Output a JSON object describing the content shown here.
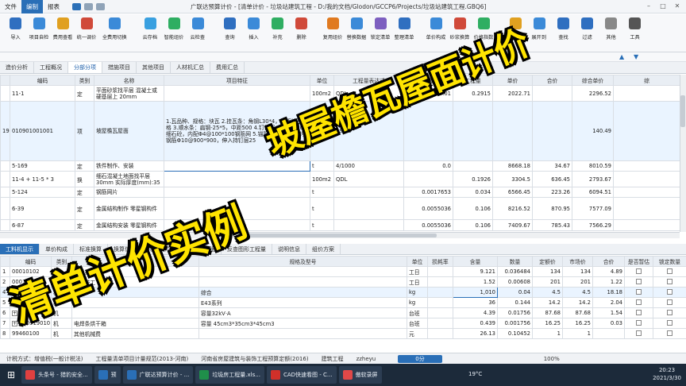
{
  "titlebar": {
    "menus": [
      "文件",
      "编制",
      "报表"
    ],
    "title": "广联达预算计价 - [清单计价 - 垃圾站建筑工程 - D:/我的文档/Glodon/GCCP6/Projects/垃圾站建筑工程.GBQ6]"
  },
  "ribbon": {
    "buttons": [
      {
        "label": "导入",
        "color": "#2f6fc0"
      },
      {
        "label": "项目自检",
        "color": "#3b8ad8"
      },
      {
        "label": "费用查看",
        "color": "#e0a020"
      },
      {
        "label": "统一调价",
        "color": "#d04a3a"
      },
      {
        "label": "全费用切换",
        "color": "#3b8ad8"
      },
      {
        "label": "云存档",
        "color": "#39a0e0"
      },
      {
        "label": "智能组价",
        "color": "#2fae62"
      },
      {
        "label": "云检查",
        "color": "#3b8ad8"
      },
      {
        "label": "查询",
        "color": "#2f6fc0"
      },
      {
        "label": "插入",
        "color": "#3b8ad8"
      },
      {
        "label": "补充",
        "color": "#2fae62"
      },
      {
        "label": "删除",
        "color": "#d04a3a"
      },
      {
        "label": "复用组价",
        "color": "#e07a20"
      },
      {
        "label": "替换数据",
        "color": "#3b8ad8"
      },
      {
        "label": "锁定清单",
        "color": "#7d5fc0"
      },
      {
        "label": "整理清单",
        "color": "#2f6fc0"
      },
      {
        "label": "单价构成",
        "color": "#3b8ad8"
      },
      {
        "label": "砂浆换算",
        "color": "#d04a3a"
      },
      {
        "label": "价格指数",
        "color": "#2fae62"
      },
      {
        "label": "颜色",
        "color": "#e0a020"
      },
      {
        "label": "展开到",
        "color": "#3b8ad8"
      },
      {
        "label": "查找",
        "color": "#2f6fc0"
      },
      {
        "label": "过滤",
        "color": "#2f6fc0"
      },
      {
        "label": "其他",
        "color": "#888888"
      },
      {
        "label": "工具",
        "color": "#555555"
      }
    ]
  },
  "top_tabs": [
    "造价分析",
    "工程概况",
    "分部分项",
    "措施项目",
    "其他项目",
    "人材机汇总",
    "费用汇总"
  ],
  "upper_table": {
    "headers": [
      "",
      "编码",
      "类别",
      "名称",
      "项目特征",
      "单位",
      "工程量表达式",
      "含量",
      "工程量",
      "单价",
      "合价",
      "综合单价",
      "综"
    ],
    "rows": [
      {
        "idx": "",
        "code": "11-1",
        "type": "定",
        "name": "平面砂浆找平层 混凝土或硬基层上 20mm",
        "feature": "",
        "unit": "100m2",
        "expr": "QDL",
        "content": "0.01",
        "qty": "0.2915",
        "price": "2022.71",
        "total": "",
        "unit_price": "2296.52"
      },
      {
        "idx": "19",
        "code": "010901001001",
        "type": "项",
        "name": "坡屋檐瓦屋面",
        "feature": "1.瓦品种、规格：块瓦 2.挂瓦条：角钢L30*4，中距按瓦规格 3.顺水条：扁钢-25*5，中距500 4.钉挂层：35厚C20细石砼，内配Φ4@100*100钢筋网 5.锚筋：屋面板内预埋钢筋Φ10@900*900，伸入持钉层25",
        "unit": "m2",
        "expr": "19.26",
        "content": "",
        "qty": "",
        "price": "",
        "total": "",
        "unit_price": "140.49"
      },
      {
        "idx": "",
        "code": "5-169",
        "type": "定",
        "name": "铁件制作、安装",
        "feature": "",
        "unit": "t",
        "expr": "4/1000",
        "content": "0.0",
        "qty": "",
        "price": "8668.18",
        "total": "34.67",
        "unit_price": "8010.59"
      },
      {
        "idx": "",
        "code": "11-4 + 11-5 * 3",
        "type": "换",
        "name": "细石混凝土地面找平层 30mm 实际厚度(mm):35",
        "feature": "",
        "unit": "100m2",
        "expr": "QDL",
        "content": "",
        "qty": "0.1926",
        "price": "3304.5",
        "total": "636.45",
        "unit_price": "2793.67"
      },
      {
        "idx": "",
        "code": "5-124",
        "type": "定",
        "name": "钢筋网片",
        "feature": "",
        "unit": "t",
        "expr": "",
        "content": "0.0017653",
        "qty": "0.034",
        "price": "6566.45",
        "total": "223.26",
        "unit_price": "6094.51"
      },
      {
        "idx": "",
        "code": "6-39",
        "type": "定",
        "name": "金属结构制作 零星钢构件",
        "feature": "",
        "unit": "t",
        "expr": "",
        "content": "0.0055036",
        "qty": "0.106",
        "price": "8216.52",
        "total": "870.95",
        "unit_price": "7577.09"
      },
      {
        "idx": "",
        "code": "6-87",
        "type": "定",
        "name": "金属结构安装 零星钢构件",
        "feature": "",
        "unit": "t",
        "expr": "",
        "content": "0.0055036",
        "qty": "0.106",
        "price": "7409.67",
        "total": "785.43",
        "unit_price": "7566.29"
      }
    ]
  },
  "bottom_tabs": [
    "工料机显示",
    "单价构成",
    "标准换算",
    "换算信息",
    "特征及内容",
    "工程量明细",
    "反查图形工程量",
    "说明信息",
    "组价方案"
  ],
  "lower_table": {
    "headers": [
      "",
      "编码",
      "类别",
      "名称",
      "规格及型号",
      "单位",
      "损耗率",
      "含量",
      "数量",
      "定额价",
      "市场价",
      "合价",
      "是否暂估",
      "锁定数量"
    ],
    "rows": [
      {
        "idx": "1",
        "code": "00010102",
        "type": "人",
        "name": "一般技工",
        "spec": "",
        "unit": "工日",
        "loss": "",
        "content": "9.121",
        "qty": "0.036484",
        "base": "134",
        "market": "134",
        "total": "4.89"
      },
      {
        "idx": "2",
        "code": "00010103",
        "type": "人",
        "name": "高级技工",
        "spec": "",
        "unit": "工日",
        "loss": "",
        "content": "1.52",
        "qty": "0.00608",
        "base": "201",
        "market": "201",
        "total": "1.22"
      },
      {
        "idx": "4",
        "code": "03210593",
        "type": "材",
        "name": "",
        "spec": "综合",
        "unit": "kg",
        "loss": "",
        "content": "1,010",
        "qty": "0.04",
        "base": "4.5",
        "market": "4.5",
        "total": "18.18"
      },
      {
        "idx": "5",
        "code": "03130921",
        "type": "材",
        "name": "",
        "spec": "E43系列",
        "unit": "kg",
        "loss": "",
        "content": "36",
        "qty": "0.144",
        "base": "14.2",
        "market": "14.2",
        "total": "2.04"
      },
      {
        "idx": "6",
        "code": "990904040",
        "type": "机",
        "name": "",
        "spec": "容量32kV·A",
        "unit": "台班",
        "loss": "",
        "content": "4.39",
        "qty": "0.01756",
        "base": "87.68",
        "market": "87.68",
        "total": "1.54"
      },
      {
        "idx": "7",
        "code": "990919010",
        "type": "机",
        "name": "电焊条烘干箱",
        "spec": "容量 45cm3*35cm3*45cm3",
        "unit": "台班",
        "loss": "",
        "content": "0.439",
        "qty": "0.001756",
        "base": "16.25",
        "market": "16.25",
        "total": "0.03"
      },
      {
        "idx": "8",
        "code": "99460100",
        "type": "机",
        "name": "其他机械费",
        "spec": "",
        "unit": "元",
        "loss": "",
        "content": "26.13",
        "qty": "0.10452",
        "base": "1",
        "market": "1",
        "total": ""
      }
    ]
  },
  "statusbar": {
    "items": [
      "计税方式：增值税(一般计税法)",
      "工程量清单项目计量规范(2013-河南)",
      "河南省房屋建筑与装饰工程预算定额(2016)",
      "建筑工程",
      "zzheyu"
    ],
    "score": "0分",
    "zoom": "100%"
  },
  "taskbar": {
    "items": [
      {
        "label": "头条号 - 猎豹安全...",
        "color": "#e04040"
      },
      {
        "label": "预",
        "color": "#2a6fb7"
      },
      {
        "label": "广联达预算计价 - ...",
        "color": "#2a6fb7"
      },
      {
        "label": "垃圾房工程量.xls...",
        "color": "#1f8f4a"
      },
      {
        "label": "CAD快速看图 - C...",
        "color": "#d0302a"
      },
      {
        "label": "傲软录屏",
        "color": "#e04848"
      }
    ],
    "temp": "19°C",
    "time": "20:23",
    "date": "2021/3/30"
  },
  "overlay": {
    "main": "清单计价实例",
    "sub": "坡屋檐瓦屋面计价"
  }
}
